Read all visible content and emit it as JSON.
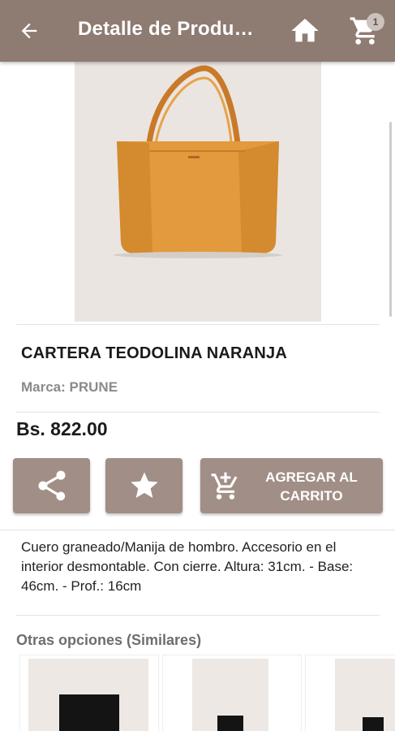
{
  "appbar": {
    "title": "Detalle de Produ…",
    "back_icon": "arrow-left-icon",
    "home_icon": "home-icon",
    "cart_icon": "shopping-cart-icon",
    "cart_count": "1"
  },
  "product": {
    "image_icon": "orange-tote-bag-image",
    "name": "CARTERA TEODOLINA NARANJA",
    "brand": "Marca: PRUNE",
    "price": "Bs. 822.00",
    "description": "Cuero graneado/Manija de hombro. Accesorio en el interior desmontable. Con cierre. Altura: 31cm. - Base: 46cm. - Prof.: 16cm"
  },
  "actions": {
    "share_icon": "share-icon",
    "favorite_icon": "star-icon",
    "add_to_cart_line1": "AGREGAR AL",
    "add_to_cart_line2": "CARRITO",
    "add_to_cart_icon": "add-shopping-cart-icon"
  },
  "similar": {
    "title": "Otras opciones (Similares)",
    "items": [
      {
        "image_icon": "black-bag-thumbnail"
      },
      {
        "image_icon": "black-bag-thumbnail"
      },
      {
        "image_icon": "black-bag-thumbnail"
      }
    ]
  },
  "colors": {
    "appbar": "#8e7b72",
    "button": "#a18e86",
    "bag": "#e39a3c"
  }
}
